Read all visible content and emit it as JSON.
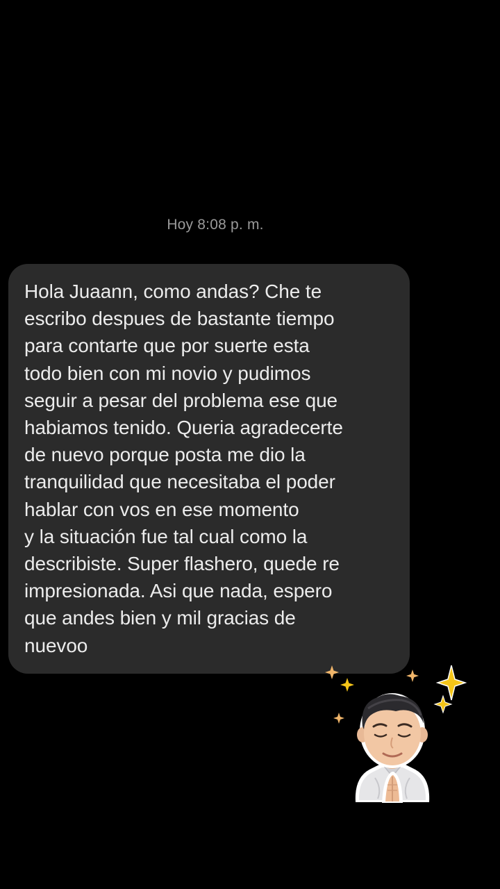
{
  "conversation": {
    "timestamp": "Hoy 8:08 p. m.",
    "message": {
      "text": "Hola Juaann, como andas? Che te\nescribo despues de bastante tiempo\npara contarte que por suerte esta\ntodo bien con mi novio y pudimos\nseguir a pesar del problema ese que\nhabiamos tenido. Queria agradecerte\nde nuevo porque posta me dio la\ntranquilidad que necesitaba el poder\nhablar con vos en ese momento\ny la situación fue tal cual como la\ndescribiste. Super flashero, quede re\nimpresionada. Asi que nada, espero\nque andes bien y mil gracias de\nnuevoo"
    },
    "sticker": {
      "icon": "praying-avatar-sticker",
      "sparkle_color": "#f5c518",
      "sparkle_light_color": "#f0b56a"
    }
  },
  "colors": {
    "background": "#000000",
    "bubble": "#2b2b2b",
    "text": "#ececec",
    "timestamp": "#9a9a9a"
  }
}
